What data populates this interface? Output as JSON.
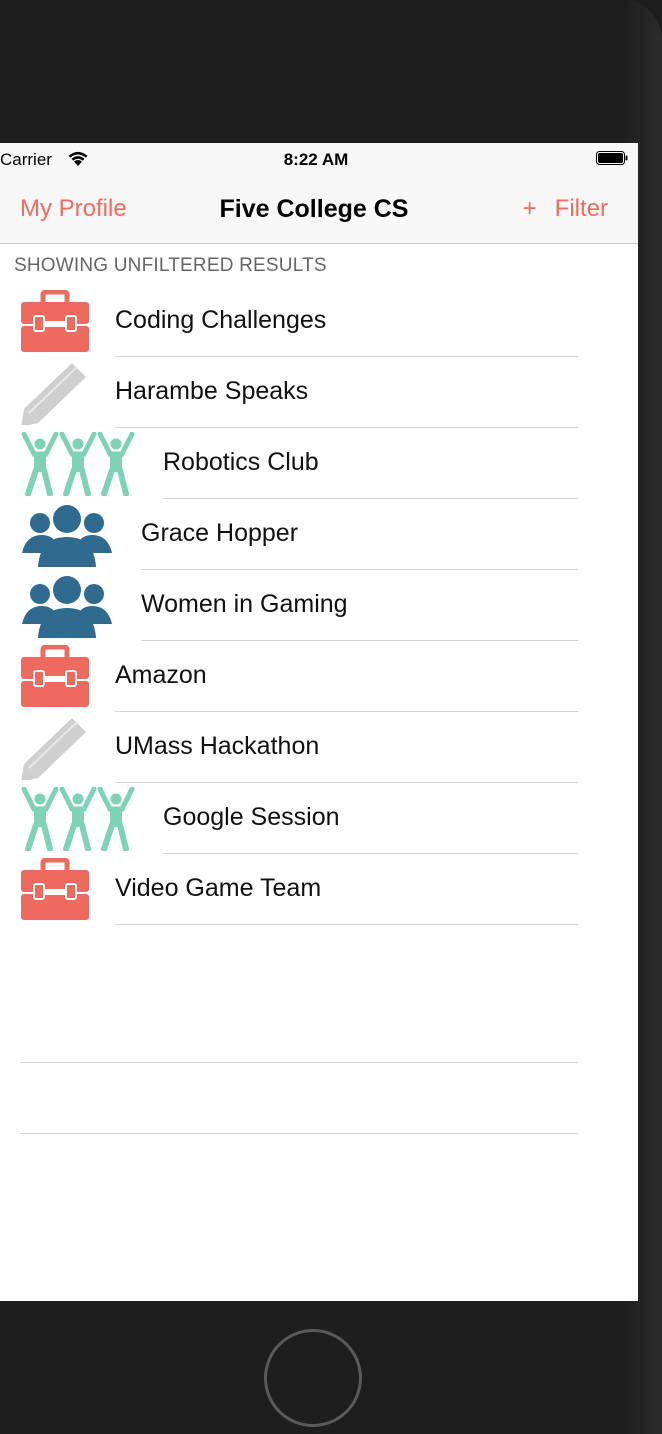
{
  "status_bar": {
    "carrier": "Carrier",
    "time": "8:22 AM"
  },
  "nav": {
    "left": "My Profile",
    "title": "Five College CS",
    "plus": "+",
    "right": "Filter"
  },
  "section_header": "SHOWING UNFILTERED RESULTS",
  "rows": [
    {
      "label": "Coding Challenges",
      "icon": "briefcase-icon"
    },
    {
      "label": "Harambe Speaks",
      "icon": "pencil-icon"
    },
    {
      "label": "Robotics Club",
      "icon": "people-dancing-icon"
    },
    {
      "label": "Grace Hopper",
      "icon": "group-icon"
    },
    {
      "label": "Women in Gaming",
      "icon": "group-icon"
    },
    {
      "label": "Amazon",
      "icon": "briefcase-icon"
    },
    {
      "label": "UMass Hackathon",
      "icon": "pencil-icon"
    },
    {
      "label": "Google Session",
      "icon": "people-dancing-icon"
    },
    {
      "label": "Video Game Team",
      "icon": "briefcase-icon"
    }
  ],
  "colors": {
    "accent": "#f06c60",
    "briefcase": "#ee6a5e",
    "pencil": "#cfcfcf",
    "dancing": "#7fd3b5",
    "group": "#2f6b8f"
  }
}
